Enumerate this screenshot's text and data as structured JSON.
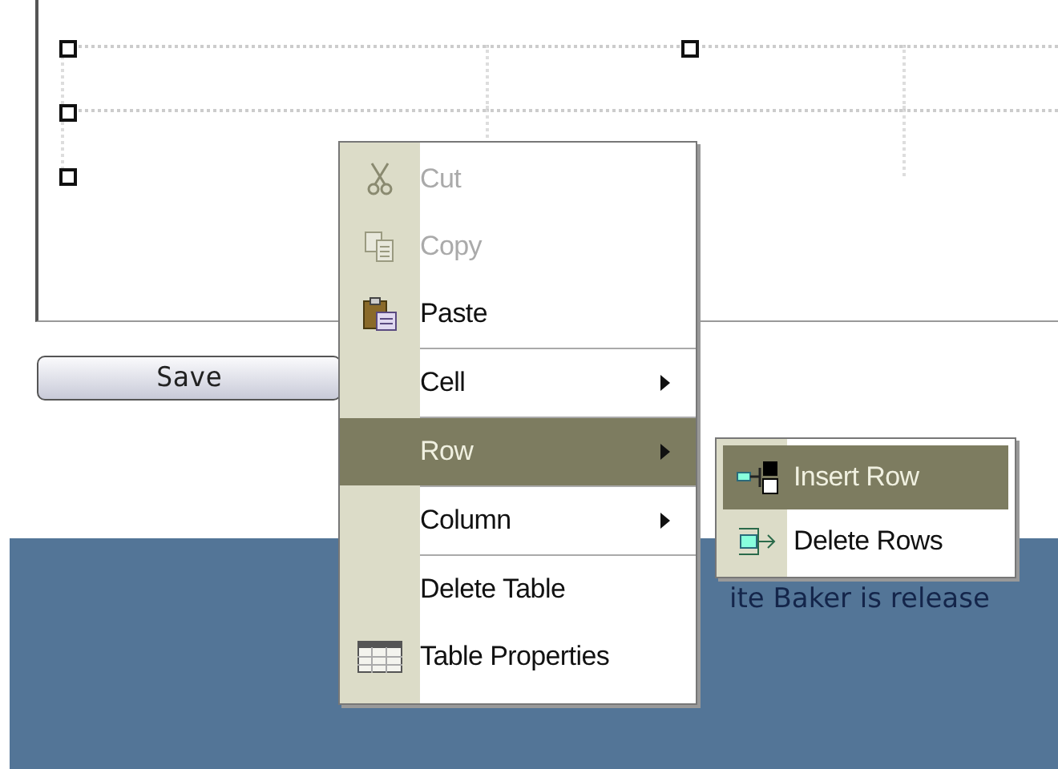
{
  "editor": {
    "save_button": "Save"
  },
  "banner": {
    "text": "ite Baker is release"
  },
  "context_menu": {
    "items": [
      {
        "label": "Cut",
        "kind": "command",
        "disabled": true,
        "selected": false,
        "separator_before": false
      },
      {
        "label": "Copy",
        "kind": "command",
        "disabled": true,
        "selected": false,
        "separator_before": false
      },
      {
        "label": "Paste",
        "kind": "command",
        "disabled": false,
        "selected": false,
        "separator_before": false
      },
      {
        "label": "Cell",
        "kind": "submenu",
        "disabled": false,
        "selected": false,
        "separator_before": true
      },
      {
        "label": "Row",
        "kind": "submenu",
        "disabled": false,
        "selected": true,
        "separator_before": true
      },
      {
        "label": "Column",
        "kind": "submenu",
        "disabled": false,
        "selected": false,
        "separator_before": true
      },
      {
        "label": "Delete Table",
        "kind": "command",
        "disabled": false,
        "selected": false,
        "separator_before": true
      },
      {
        "label": "Table Properties",
        "kind": "command",
        "disabled": false,
        "selected": false,
        "separator_before": false
      }
    ]
  },
  "submenu": {
    "items": [
      {
        "label": "Insert Row",
        "selected": true
      },
      {
        "label": "Delete Rows",
        "selected": false
      }
    ]
  }
}
